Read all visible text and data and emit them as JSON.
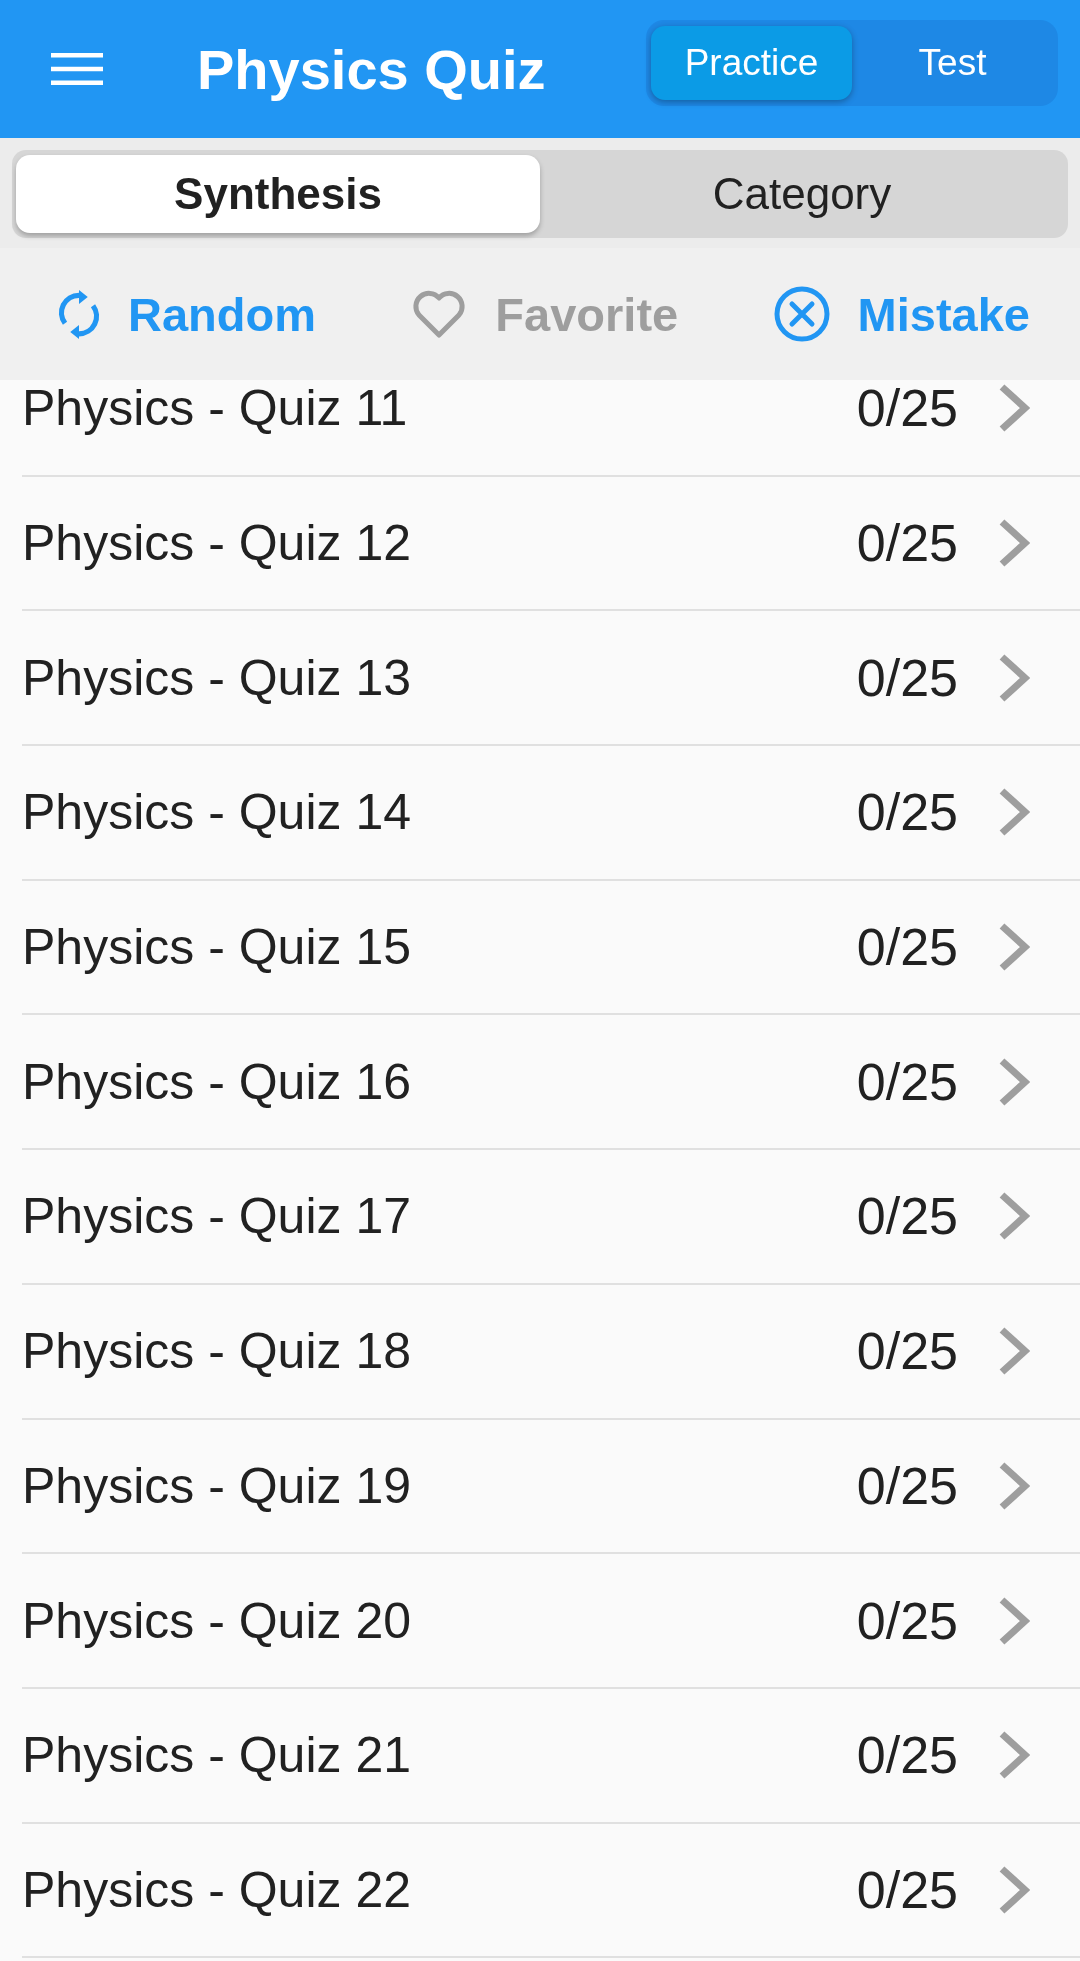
{
  "app_bar": {
    "title": "Physics Quiz",
    "modes": [
      {
        "label": "Practice",
        "selected": true
      },
      {
        "label": "Test",
        "selected": false
      }
    ]
  },
  "segments": [
    {
      "label": "Synthesis",
      "selected": true
    },
    {
      "label": "Category",
      "selected": false
    }
  ],
  "filters": [
    {
      "label": "Random",
      "kind": "random",
      "active": true
    },
    {
      "label": "Favorite",
      "kind": "favorite",
      "active": false
    },
    {
      "label": "Mistake",
      "kind": "mistake",
      "active": true
    }
  ],
  "quizzes": [
    {
      "title": "Physics - Quiz 11",
      "score": "0/25"
    },
    {
      "title": "Physics - Quiz 12",
      "score": "0/25"
    },
    {
      "title": "Physics - Quiz 13",
      "score": "0/25"
    },
    {
      "title": "Physics - Quiz 14",
      "score": "0/25"
    },
    {
      "title": "Physics - Quiz 15",
      "score": "0/25"
    },
    {
      "title": "Physics - Quiz 16",
      "score": "0/25"
    },
    {
      "title": "Physics - Quiz 17",
      "score": "0/25"
    },
    {
      "title": "Physics - Quiz 18",
      "score": "0/25"
    },
    {
      "title": "Physics - Quiz 19",
      "score": "0/25"
    },
    {
      "title": "Physics - Quiz 20",
      "score": "0/25"
    },
    {
      "title": "Physics - Quiz 21",
      "score": "0/25"
    },
    {
      "title": "Physics - Quiz 22",
      "score": "0/25"
    }
  ]
}
